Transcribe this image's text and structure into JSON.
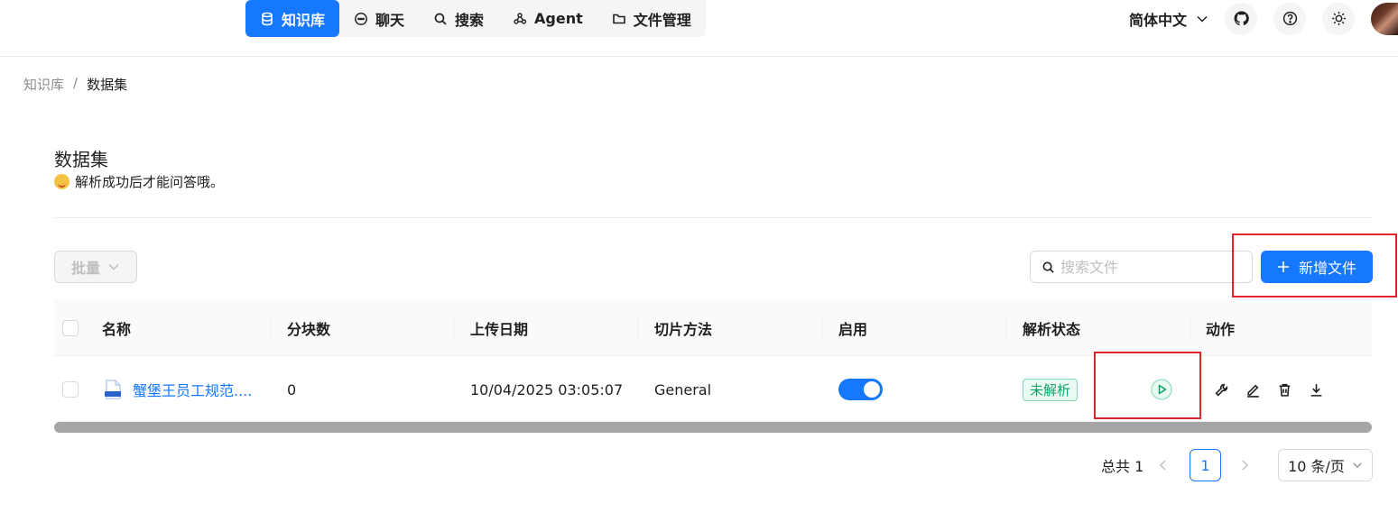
{
  "nav": {
    "items": [
      {
        "label": "知识库",
        "icon": "database-icon",
        "active": true
      },
      {
        "label": "聊天",
        "icon": "chat-bubble-icon",
        "active": false
      },
      {
        "label": "搜索",
        "icon": "search-icon",
        "active": false
      },
      {
        "label": "Agent",
        "icon": "graph-nodes-icon",
        "active": false
      },
      {
        "label": "文件管理",
        "icon": "folder-icon",
        "active": false
      }
    ],
    "language": "简体中文"
  },
  "breadcrumb": {
    "root": "知识库",
    "separator": "/",
    "current": "数据集"
  },
  "page": {
    "title": "数据集",
    "subtitle": "解析成功后才能问答哦。"
  },
  "toolbar": {
    "batch_label": "批量",
    "search_placeholder": "搜索文件",
    "add_label": "新增文件"
  },
  "table": {
    "columns": [
      "名称",
      "分块数",
      "上传日期",
      "切片方法",
      "启用",
      "解析状态",
      "动作"
    ],
    "rows": [
      {
        "name": "蟹堡王员工规范....",
        "file_type": "DOCX",
        "chunks": "0",
        "upload_date": "10/04/2025 03:05:07",
        "chunk_method": "General",
        "enabled": true,
        "parse_status": "未解析"
      }
    ]
  },
  "pagination": {
    "total_label": "总共 1",
    "current_page": "1",
    "page_size": "10 条/页"
  },
  "colors": {
    "primary": "#1677ff",
    "success": "#13a16a",
    "highlight": "#e0242f"
  }
}
